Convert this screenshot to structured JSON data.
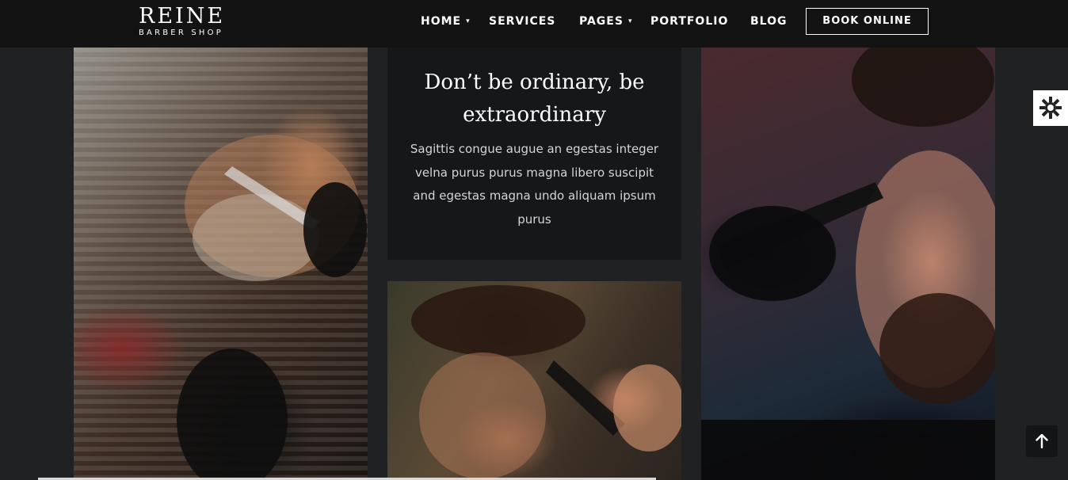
{
  "brand": {
    "name": "REINE",
    "tagline": "BARBER SHOP"
  },
  "nav": {
    "items": [
      {
        "label": "HOME",
        "has_dropdown": true
      },
      {
        "label": "SERVICES",
        "has_dropdown": false
      },
      {
        "label": "PAGES",
        "has_dropdown": true
      },
      {
        "label": "PORTFOLIO",
        "has_dropdown": false
      },
      {
        "label": "BLOG",
        "has_dropdown": false
      }
    ],
    "cta_label": "BOOK ONLINE"
  },
  "feature": {
    "title": "Don’t be ordinary, be extraordinary",
    "body": "Sagittis congue augue an egestas integer velna purus purus magna libero suscipit and egestas magna undo aliquam ipsum purus"
  },
  "widgets": {
    "settings_icon": "gear-icon",
    "back_to_top_icon": "arrow-up-icon"
  },
  "colors": {
    "page_bg": "#1f2123",
    "header_bg": "#131313",
    "card_bg": "#161719",
    "text": "#ffffff"
  }
}
